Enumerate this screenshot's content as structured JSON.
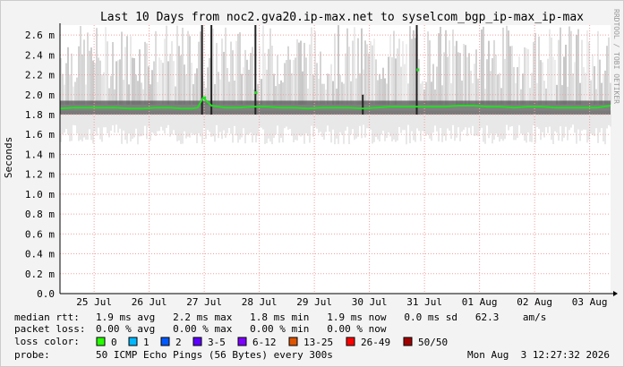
{
  "chart_data": {
    "type": "line",
    "title": "Last 10 Days from noc2.gva20.ip-max.net to syselcom_bgp_ip-max_ip-max",
    "ylabel": "Seconds",
    "watermark": "RRDTOOL / TOBI OETIKER",
    "ylim": [
      0,
      2.7
    ],
    "yticks": [
      {
        "value": 0.0,
        "label": "0.0"
      },
      {
        "value": 0.2,
        "label": "0.2 m"
      },
      {
        "value": 0.4,
        "label": "0.4 m"
      },
      {
        "value": 0.6,
        "label": "0.6 m"
      },
      {
        "value": 0.8,
        "label": "0.8 m"
      },
      {
        "value": 1.0,
        "label": "1.0 m"
      },
      {
        "value": 1.2,
        "label": "1.2 m"
      },
      {
        "value": 1.4,
        "label": "1.4 m"
      },
      {
        "value": 1.6,
        "label": "1.6 m"
      },
      {
        "value": 1.8,
        "label": "1.8 m"
      },
      {
        "value": 2.0,
        "label": "2.0 m"
      },
      {
        "value": 2.2,
        "label": "2.2 m"
      },
      {
        "value": 2.4,
        "label": "2.4 m"
      },
      {
        "value": 2.6,
        "label": "2.6 m"
      }
    ],
    "xlim": [
      0,
      10
    ],
    "xticks": [
      {
        "value": 0.62,
        "label": "25 Jul"
      },
      {
        "value": 1.62,
        "label": "26 Jul"
      },
      {
        "value": 2.62,
        "label": "27 Jul"
      },
      {
        "value": 3.62,
        "label": "28 Jul"
      },
      {
        "value": 4.62,
        "label": "29 Jul"
      },
      {
        "value": 5.62,
        "label": "30 Jul"
      },
      {
        "value": 6.62,
        "label": "31 Jul"
      },
      {
        "value": 7.62,
        "label": "01 Aug"
      },
      {
        "value": 8.62,
        "label": "02 Aug"
      },
      {
        "value": 9.62,
        "label": "03 Aug"
      }
    ],
    "series": [
      {
        "name": "median rtt",
        "color": "#22dd22",
        "x": [
          0,
          0.25,
          0.5,
          0.75,
          1.0,
          1.25,
          1.5,
          1.75,
          2.0,
          2.2,
          2.4,
          2.5,
          2.6,
          2.75,
          3.0,
          3.25,
          3.5,
          3.75,
          4.0,
          4.25,
          4.5,
          4.75,
          5.0,
          5.25,
          5.5,
          5.75,
          6.0,
          6.25,
          6.5,
          6.75,
          7.0,
          7.25,
          7.5,
          7.75,
          8.0,
          8.25,
          8.5,
          8.75,
          9.0,
          9.25,
          9.5,
          9.75,
          10.0
        ],
        "y": [
          1.86,
          1.87,
          1.87,
          1.87,
          1.87,
          1.86,
          1.86,
          1.87,
          1.87,
          1.86,
          1.86,
          1.87,
          1.97,
          1.89,
          1.87,
          1.87,
          1.88,
          1.88,
          1.87,
          1.87,
          1.86,
          1.87,
          1.87,
          1.87,
          1.86,
          1.87,
          1.88,
          1.88,
          1.88,
          1.88,
          1.88,
          1.89,
          1.89,
          1.88,
          1.88,
          1.87,
          1.88,
          1.88,
          1.87,
          1.87,
          1.87,
          1.87,
          1.89
        ]
      }
    ],
    "spikes": [
      {
        "x": 2.58,
        "y": 2.7
      },
      {
        "x": 2.75,
        "y": 2.7
      },
      {
        "x": 3.55,
        "y": 2.7
      },
      {
        "x": 6.48,
        "y": 2.7
      },
      {
        "x": 5.5,
        "y": 2.0
      }
    ],
    "outliers": [
      {
        "x": 3.56,
        "y": 2.02
      },
      {
        "x": 6.5,
        "y": 2.25
      },
      {
        "x": 2.63,
        "y": 1.97
      }
    ],
    "grid": true
  },
  "stats": {
    "median_label": "median rtt:",
    "median_values": "1.9 ms avg   2.2 ms max   1.8 ms min   1.9 ms now   0.0 ms sd   62.3    am/s",
    "loss_label": "packet loss:",
    "loss_values": "0.00 % avg   0.00 % max   0.00 % min   0.00 % now",
    "color_label": "loss color:",
    "probe_label": "probe:",
    "probe_value": "50 ICMP Echo Pings (56 Bytes) every 300s",
    "timestamp": "Mon Aug  3 12:27:32 2026"
  },
  "loss_colors": [
    {
      "label": "0",
      "color": "#26ff00"
    },
    {
      "label": "1",
      "color": "#00b8ff"
    },
    {
      "label": "2",
      "color": "#0059ff"
    },
    {
      "label": "3-5",
      "color": "#5e00ff"
    },
    {
      "label": "6-12",
      "color": "#7e00ff"
    },
    {
      "label": "13-25",
      "color": "#dd5500"
    },
    {
      "label": "26-49",
      "color": "#ff0000"
    },
    {
      "label": "50/50",
      "color": "#a10000"
    }
  ]
}
